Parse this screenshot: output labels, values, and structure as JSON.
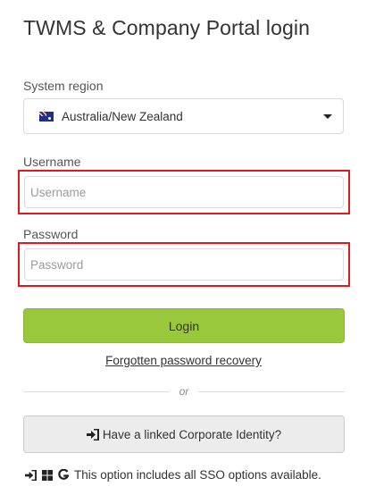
{
  "header": {
    "title": "TWMS & Company Portal login"
  },
  "region": {
    "label": "System region",
    "selected": "Australia/New Zealand",
    "flag_icon": "australia-flag-icon"
  },
  "username": {
    "label": "Username",
    "placeholder": "Username",
    "value": ""
  },
  "password": {
    "label": "Password",
    "placeholder": "Password",
    "value": ""
  },
  "login_button": {
    "label": "Login",
    "color": "#99c93b"
  },
  "recovery_link": "Forgotten password recovery",
  "divider_text": "or",
  "sso_button": {
    "label": "Have a linked Corporate Identity?",
    "icon": "sign-in-icon"
  },
  "sso_note": {
    "text": "This option includes all SSO options available.",
    "icons": [
      "sign-in-icon",
      "windows-icon",
      "google-icon"
    ]
  },
  "highlight_color": "#e0191c"
}
